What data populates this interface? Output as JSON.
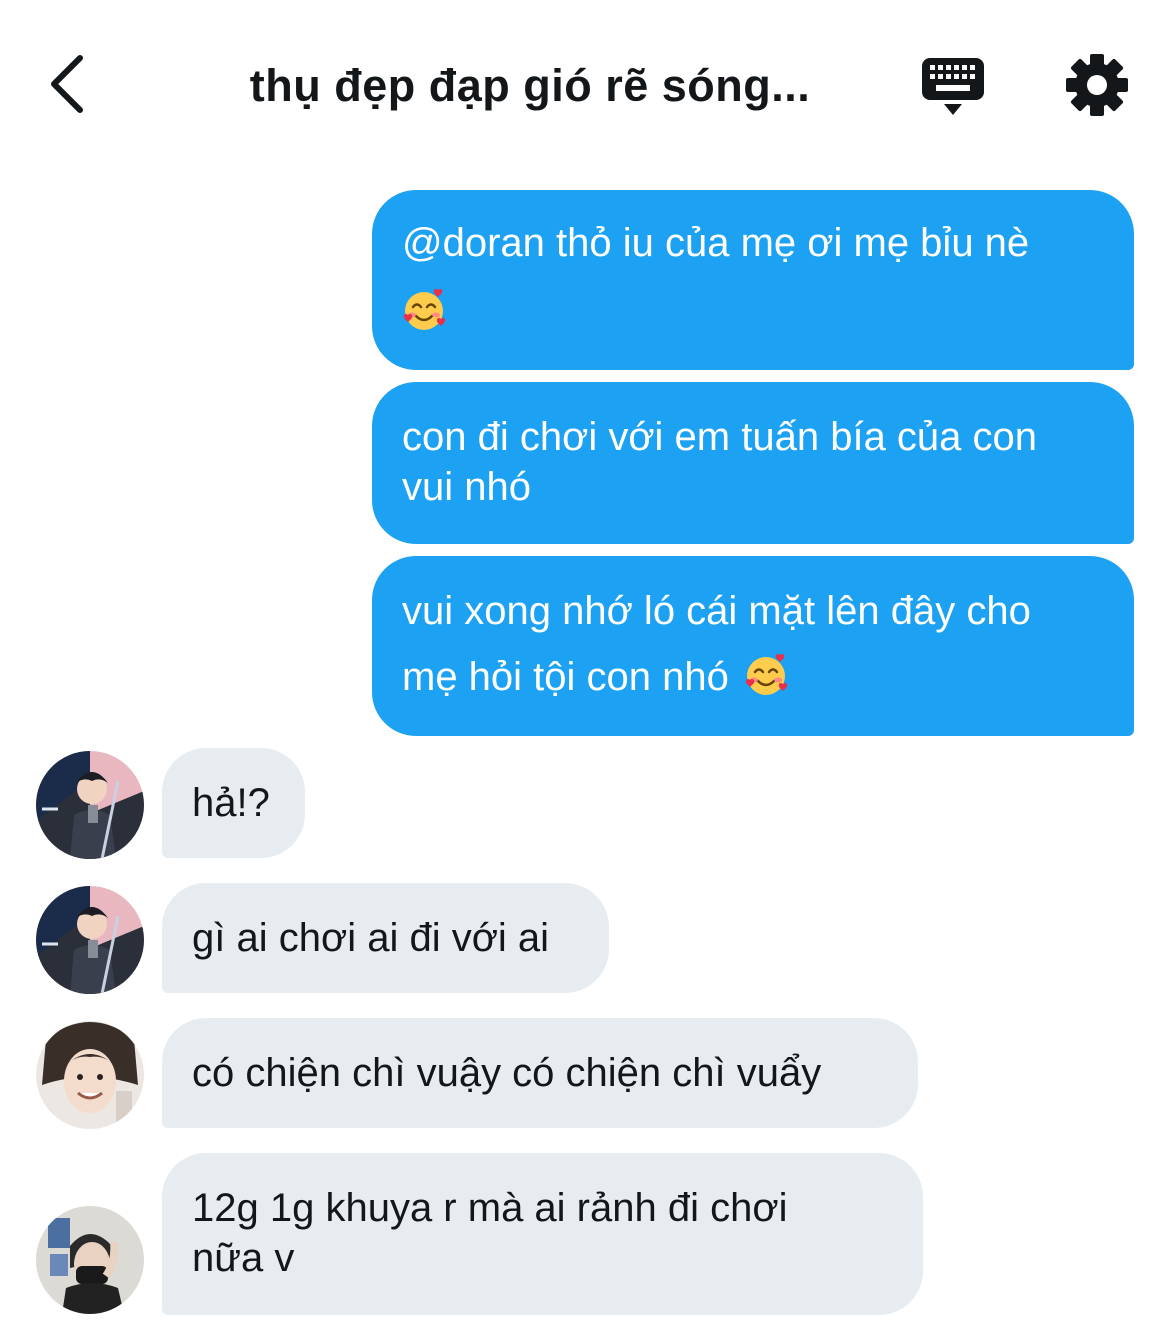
{
  "header": {
    "title": "thụ đẹp đạp gió rẽ sóng...",
    "back_icon": "chevron-left-icon",
    "keyboard_icon": "keyboard-hide-icon",
    "settings_icon": "gear-icon"
  },
  "colors": {
    "outgoing_bubble": "#1da1f2",
    "incoming_bubble": "#e6ecf0",
    "text": "#14171a"
  },
  "messages": [
    {
      "direction": "outgoing",
      "lines": [
        "@doran thỏ iu của mẹ ơi mẹ bỉu nè"
      ],
      "trailing_emoji": "smiling-face-with-hearts"
    },
    {
      "direction": "outgoing",
      "lines": [
        "con đi chơi với em tuấn bía của con",
        "vui nhó"
      ]
    },
    {
      "direction": "outgoing",
      "lines": [
        "vui xong nhớ ló cái mặt lên đây cho",
        "mẹ hỏi tội con nhó"
      ],
      "trailing_emoji": "smiling-face-with-hearts"
    },
    {
      "direction": "incoming",
      "lines": [
        "hả!?"
      ],
      "avatar": "avatar-user-1"
    },
    {
      "direction": "incoming",
      "lines": [
        "gì ai chơi ai đi với ai"
      ],
      "avatar": "avatar-user-1"
    },
    {
      "direction": "incoming",
      "lines": [
        "có chiện chì vuậy có chiện chì vuẩy"
      ],
      "avatar": "avatar-user-2"
    },
    {
      "direction": "incoming",
      "lines": [
        "12g 1g khuya r mà ai rảnh đi chơi",
        "nữa v"
      ],
      "avatar": "avatar-user-3"
    }
  ]
}
